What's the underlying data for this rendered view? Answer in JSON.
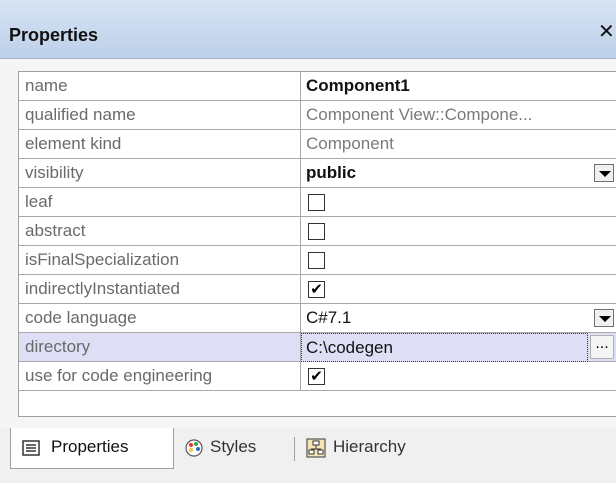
{
  "window": {
    "title": "Properties",
    "close_glyph": "✕"
  },
  "properties": [
    {
      "name": "name",
      "value": "Component1",
      "kind": "text"
    },
    {
      "name": "qualified name",
      "value": "Component View::Compone...",
      "kind": "readonly"
    },
    {
      "name": "element kind",
      "value": "Component",
      "kind": "readonly"
    },
    {
      "name": "visibility",
      "value": "public",
      "kind": "dropdown"
    },
    {
      "name": "leaf",
      "checked": false,
      "kind": "checkbox"
    },
    {
      "name": "abstract",
      "checked": false,
      "kind": "checkbox"
    },
    {
      "name": "isFinalSpecialization",
      "checked": false,
      "kind": "checkbox"
    },
    {
      "name": "indirectlyInstantiated",
      "checked": true,
      "kind": "checkbox"
    },
    {
      "name": "code language",
      "value": "C#7.1",
      "kind": "dropdown"
    },
    {
      "name": "directory",
      "value": "C:\\codegen",
      "kind": "input",
      "button_label": "..."
    },
    {
      "name": "use for code engineering",
      "checked": true,
      "kind": "checkbox"
    }
  ],
  "check_glyph": "✔",
  "tabs": [
    {
      "label": "Properties",
      "icon": "properties-icon",
      "active": true
    },
    {
      "label": "Styles",
      "icon": "palette-icon",
      "active": false
    },
    {
      "label": "Hierarchy",
      "icon": "hierarchy-icon",
      "active": false
    }
  ],
  "colors": {
    "titlebar": "#c6d7ee",
    "highlight_row": "#dedef5",
    "label_text": "#6a6a6a"
  }
}
